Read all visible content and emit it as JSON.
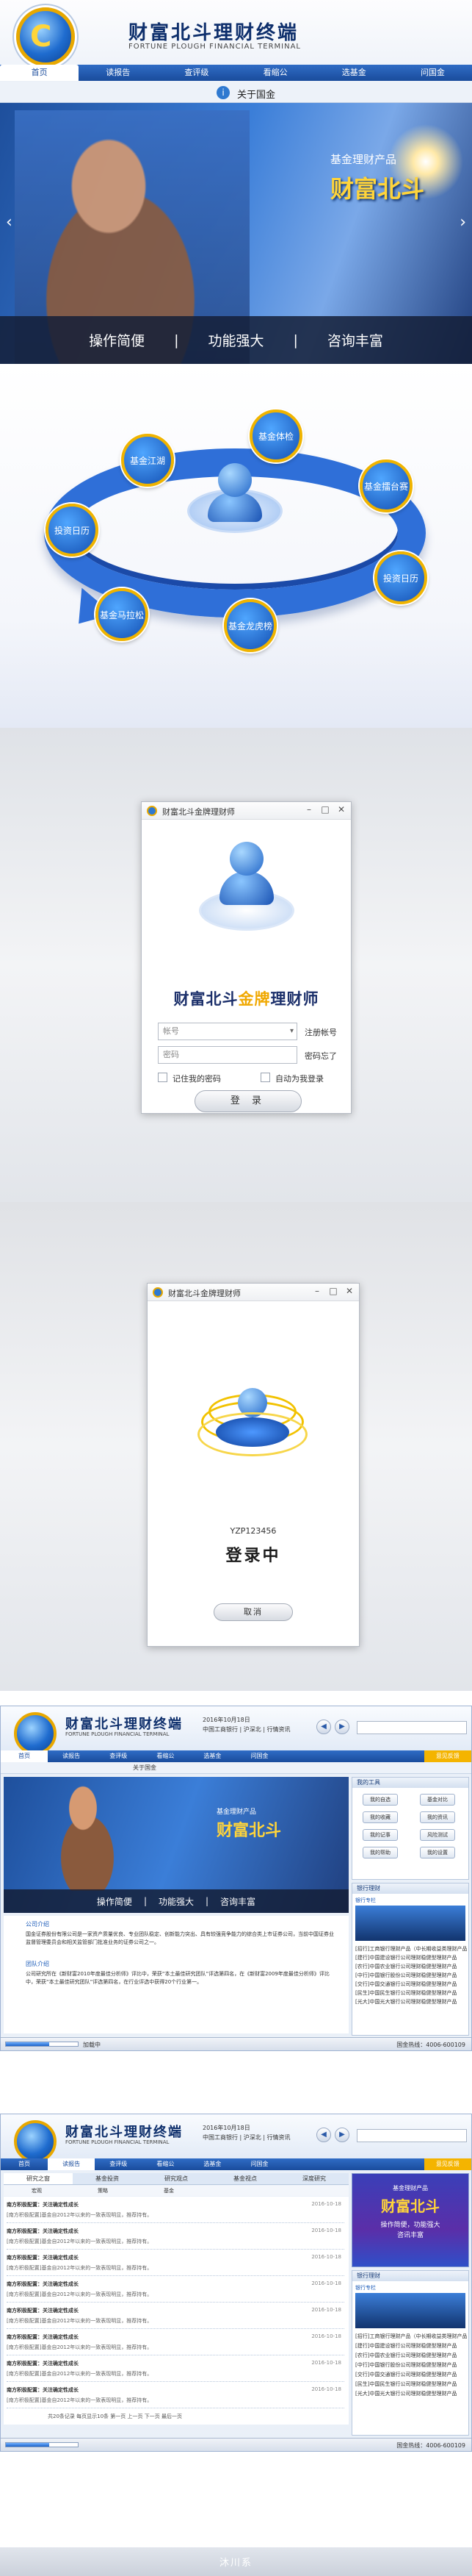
{
  "header": {
    "brand": "财富北斗理财终端",
    "brand_en": "FORTUNE PLOUGH FINANCIAL TERMINAL",
    "nav": [
      "首页",
      "读报告",
      "查评级",
      "看缩公",
      "选基金",
      "问国金"
    ],
    "sub_icon": "info-icon",
    "sub_label": "关于国金"
  },
  "banner": {
    "subtitle": "基金理财产品",
    "title": "财富北斗",
    "strip": [
      "操作简便",
      "功能强大",
      "咨询丰富"
    ],
    "left_arrow": "‹",
    "right_arrow": "›"
  },
  "diagram": {
    "nodes": [
      "基金江湖",
      "基金体检",
      "基金擂台赛",
      "投资日历",
      "基金龙虎榜",
      "基金马拉松",
      "投资日历"
    ]
  },
  "login": {
    "window_title": "财富北斗金牌理财师",
    "controls": [
      "–",
      "□",
      "✕"
    ],
    "title_pre": "财富北斗",
    "title_gold": "金牌",
    "title_post": "理财师",
    "account_placeholder": "帐号",
    "password_placeholder": "密码",
    "register_link": "注册帐号",
    "forgot_link": "密码忘了",
    "remember_label": "记住我的密码",
    "autologin_label": "自动为我登录",
    "login_button": "登 录"
  },
  "loading": {
    "window_title": "财富北斗金牌理财师",
    "user_id": "YZP123456",
    "status": "登录中",
    "cancel_button": "取消"
  },
  "main_window": {
    "brand": "财富北斗理财终端",
    "brand_en": "FORTUNE PLOUGH FINANCIAL TERMINAL",
    "info_lines": [
      "2016年10月18日",
      "中国工商银行 | 沪深北 | 行情资讯"
    ],
    "nav": [
      "首页",
      "读报告",
      "查评级",
      "看缩公",
      "选基金",
      "问国金",
      "",
      "",
      "",
      "意见反馈"
    ],
    "sub_label": "关于国金",
    "banner_subtitle": "基金理财产品",
    "banner_title": "财富北斗",
    "strip": [
      "操作简便",
      "功能强大",
      "咨询丰富"
    ],
    "intro_title": "公司介绍",
    "intro_text": "国金证券股份有限公司是一家资产质量优良、专业团队稳定、创新能力突出、具有较强竞争能力的综合类上市证券公司，当前中国证券业监督管理委员会和相关监管部门批准业务的证券公司之一。",
    "team_title": "团队介绍",
    "team_text": "公司研究所在《新财富2010年度最佳分析师》评比中，荣获“本土最佳研究团队”评选第四名，在《新财富2009年度最佳分析师》评比中，荣获“本土最佳研究团队”评选第四名，在行业评选中获得20个行业第一。",
    "tools_title": "我的工具",
    "tools": [
      "我的自选",
      "我的收藏",
      "我的记事",
      "我的帮助",
      "基金对比",
      "我的资讯",
      "风险测试",
      "我的设置"
    ],
    "news_title": "银行理财",
    "news_sub": "银行专栏",
    "news_items": [
      "[招行]工商银行理财产品（中长期收益类理财产品）",
      "[建行]中国建设银行公司理财稳健型理财产品",
      "[农行]中国农业银行公司理财稳健型理财产品",
      "[中行]中国银行股份公司理财稳健型理财产品",
      "[交行]中国交通银行公司理财稳健型理财产品",
      "[民生]中国民生银行公司理财稳健型理财产品",
      "[光大]中国光大银行公司理财稳健型理财产品"
    ],
    "status_left": "加载中",
    "status_right": "国金热线：4006-600109"
  },
  "research_window": {
    "tabs": [
      "研究之窗",
      "基金投资",
      "研究观点",
      "基金视点",
      "深度研究"
    ],
    "subtabs": [
      "宏观",
      "策略",
      "基金"
    ],
    "ad_subtitle": "基金理财产品",
    "ad_title": "财富北斗",
    "ad_lines": [
      "操作简便，功能强大",
      "咨讯丰富"
    ],
    "reports": [
      {
        "title": "南方积极配置：关注确定性成长",
        "date": "2016-10-18"
      },
      {
        "title": "南方积极配置：关注确定性成长",
        "date": "2016-10-18"
      },
      {
        "title": "南方积极配置：关注确定性成长",
        "date": "2016-10-18"
      },
      {
        "title": "南方积极配置：关注确定性成长",
        "date": "2016-10-18"
      },
      {
        "title": "南方积极配置：关注确定性成长",
        "date": "2016-10-18"
      },
      {
        "title": "南方积极配置：关注确定性成长",
        "date": "2016-10-18"
      },
      {
        "title": "南方积极配置：关注确定性成长",
        "date": "2016-10-18"
      },
      {
        "title": "南方积极配置：关注确定性成长",
        "date": "2016-10-18"
      }
    ],
    "report_desc": "[南方积极配置]基金自2012年以来的一致表现明显，推荐持有。",
    "pager": "共20条记录  每页显示10条  第一页  上一页  下一页  最后一页",
    "status_right": "国金热线：4006-600109"
  },
  "footer": {
    "text": "沐川系"
  },
  "colors": {
    "brand_blue": "#1a4c9c",
    "gold": "#f0b400"
  }
}
